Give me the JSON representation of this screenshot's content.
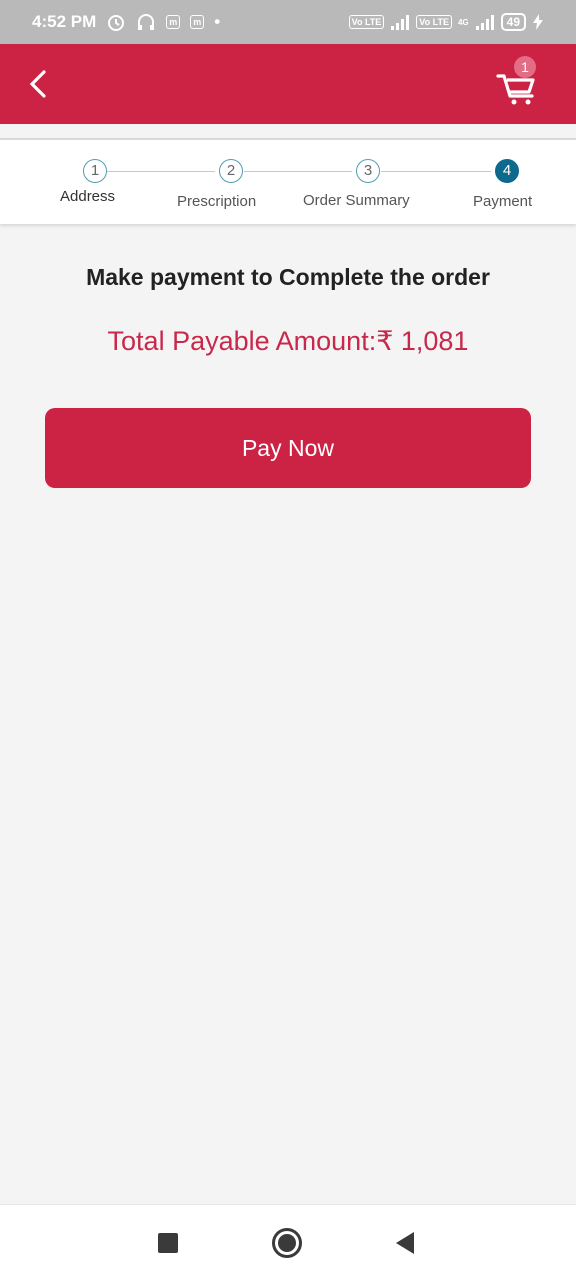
{
  "status_bar": {
    "time": "4:52 PM",
    "icons": [
      "alarm-icon",
      "headphones-icon",
      "m-app-icon",
      "m-app-icon",
      "dot-icon",
      "volte-icon",
      "signal-icon",
      "volte-icon",
      "4g-signal-icon"
    ],
    "volte_label": "Vo LTE",
    "network_label": "4G",
    "battery": "49"
  },
  "app_bar": {
    "color": "#cc2244",
    "cart_count": "1"
  },
  "stepper": {
    "steps": [
      {
        "number": "1",
        "label": "Address"
      },
      {
        "number": "2",
        "label": "Prescription"
      },
      {
        "number": "3",
        "label": "Order Summary"
      },
      {
        "number": "4",
        "label": "Payment"
      }
    ],
    "active_step": 4,
    "active_color": "#0e6a8c"
  },
  "main": {
    "headline": "Make payment to Complete the order",
    "amount_text": "Total Payable Amount:₹ 1,081",
    "pay_button": "Pay Now"
  },
  "nav_bar": {
    "buttons": [
      "recent-apps",
      "home",
      "back"
    ]
  }
}
